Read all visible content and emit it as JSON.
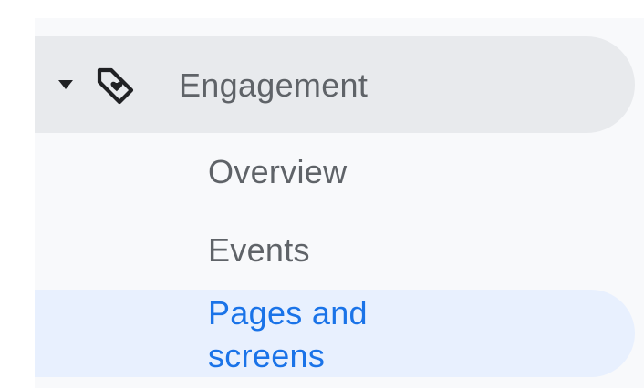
{
  "nav": {
    "group": {
      "label": "Engagement",
      "caret_icon": "caret-down-icon",
      "icon": "tag-heart-icon",
      "expanded": true
    },
    "items": [
      {
        "label": "Overview",
        "active": false
      },
      {
        "label": "Events",
        "active": false
      },
      {
        "label": "Pages and screens",
        "active": true
      }
    ]
  },
  "colors": {
    "panel_bg": "#f8f9fb",
    "group_header_bg": "#e8eaed",
    "text": "#5f6368",
    "active_bg": "#e8f0fe",
    "active_text": "#1a73e8",
    "icon": "#202124"
  }
}
